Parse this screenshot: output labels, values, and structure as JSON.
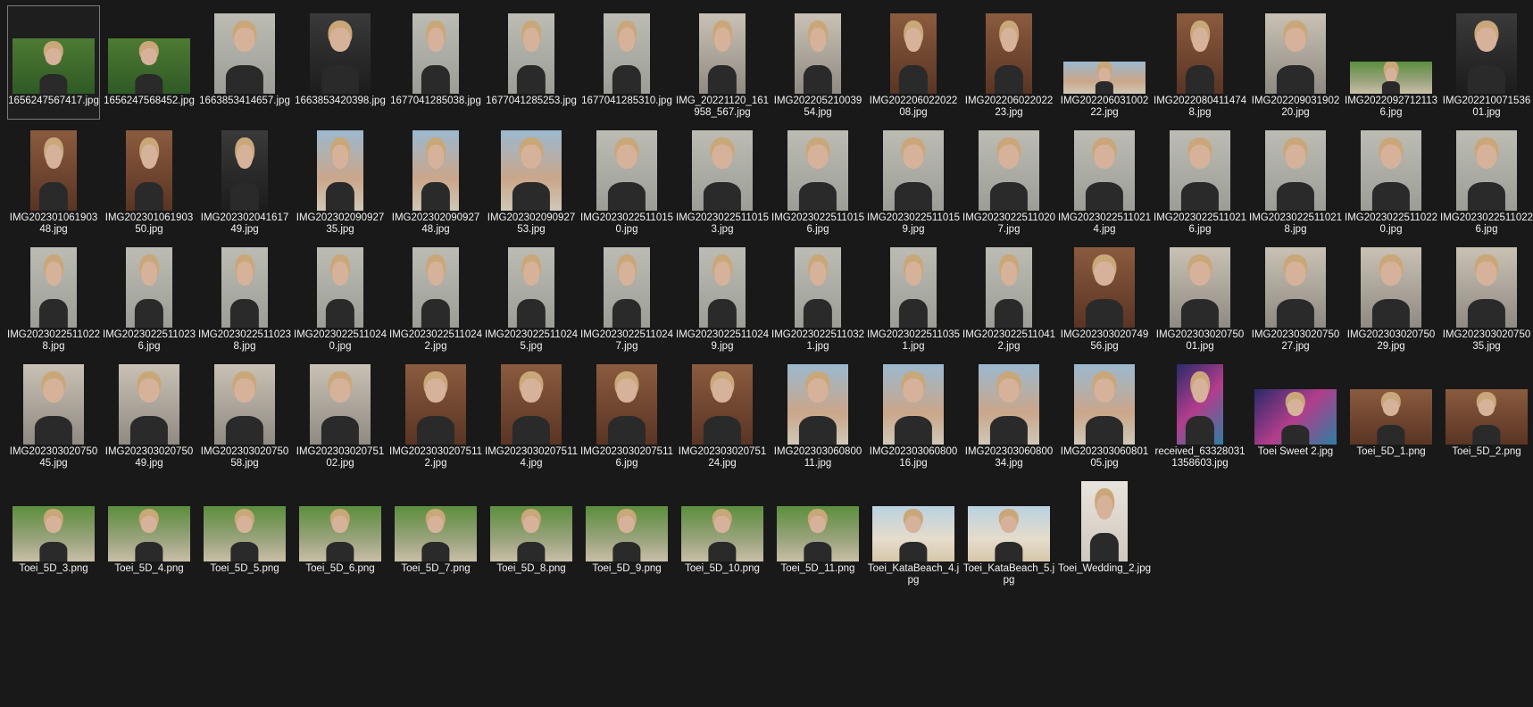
{
  "files": [
    {
      "name": "1656247567417.jpg",
      "thumb": "land green",
      "selected": true
    },
    {
      "name": "1656247568452.jpg",
      "thumb": "land green"
    },
    {
      "name": "1663853414657.jpg",
      "thumb": "portrait grey"
    },
    {
      "name": "1663853420398.jpg",
      "thumb": "portrait dark"
    },
    {
      "name": "1677041285038.jpg",
      "thumb": "tall grey"
    },
    {
      "name": "1677041285253.jpg",
      "thumb": "tall grey"
    },
    {
      "name": "1677041285310.jpg",
      "thumb": "tall grey"
    },
    {
      "name": "IMG_20221120_161958_567.jpg",
      "thumb": "tall room"
    },
    {
      "name": "IMG20220521003954.jpg",
      "thumb": "tall room"
    },
    {
      "name": "IMG20220602202208.jpg",
      "thumb": "tall warm"
    },
    {
      "name": "IMG20220602202223.jpg",
      "thumb": "tall warm"
    },
    {
      "name": "IMG20220603100222.jpg",
      "thumb": "wide outdoor"
    },
    {
      "name": "IMG20220804114748.jpg",
      "thumb": "tall warm"
    },
    {
      "name": "IMG20220903190220.jpg",
      "thumb": "portrait room"
    },
    {
      "name": "IMG20220927121136.jpg",
      "thumb": "wide park"
    },
    {
      "name": "IMG20221007153601.jpg",
      "thumb": "portrait dark"
    },
    {
      "name": "IMG20230106190348.jpg",
      "thumb": "tall warm"
    },
    {
      "name": "IMG20230106190350.jpg",
      "thumb": "tall warm"
    },
    {
      "name": "IMG20230204161749.jpg",
      "thumb": "tall dark"
    },
    {
      "name": "IMG20230209092735.jpg",
      "thumb": "tall outdoor"
    },
    {
      "name": "IMG20230209092748.jpg",
      "thumb": "tall outdoor"
    },
    {
      "name": "IMG20230209092753.jpg",
      "thumb": "portrait outdoor"
    },
    {
      "name": "IMG20230225110150.jpg",
      "thumb": "portrait grey"
    },
    {
      "name": "IMG20230225110153.jpg",
      "thumb": "portrait grey"
    },
    {
      "name": "IMG20230225110156.jpg",
      "thumb": "portrait grey"
    },
    {
      "name": "IMG20230225110159.jpg",
      "thumb": "portrait grey"
    },
    {
      "name": "IMG20230225110207.jpg",
      "thumb": "portrait grey"
    },
    {
      "name": "IMG20230225110214.jpg",
      "thumb": "portrait grey"
    },
    {
      "name": "IMG20230225110216.jpg",
      "thumb": "portrait grey"
    },
    {
      "name": "IMG20230225110218.jpg",
      "thumb": "portrait grey"
    },
    {
      "name": "IMG20230225110220.jpg",
      "thumb": "portrait grey"
    },
    {
      "name": "IMG20230225110226.jpg",
      "thumb": "portrait grey"
    },
    {
      "name": "IMG20230225110228.jpg",
      "thumb": "tall grey"
    },
    {
      "name": "IMG20230225110236.jpg",
      "thumb": "tall grey"
    },
    {
      "name": "IMG20230225110238.jpg",
      "thumb": "tall grey"
    },
    {
      "name": "IMG20230225110240.jpg",
      "thumb": "tall grey"
    },
    {
      "name": "IMG20230225110242.jpg",
      "thumb": "tall grey"
    },
    {
      "name": "IMG20230225110245.jpg",
      "thumb": "tall grey"
    },
    {
      "name": "IMG20230225110247.jpg",
      "thumb": "tall grey"
    },
    {
      "name": "IMG20230225110249.jpg",
      "thumb": "tall grey"
    },
    {
      "name": "IMG20230225110321.jpg",
      "thumb": "tall grey"
    },
    {
      "name": "IMG20230225110351.jpg",
      "thumb": "tall grey"
    },
    {
      "name": "IMG20230225110412.jpg",
      "thumb": "tall grey"
    },
    {
      "name": "IMG20230302074956.jpg",
      "thumb": "portrait warm"
    },
    {
      "name": "IMG20230302075001.jpg",
      "thumb": "portrait room"
    },
    {
      "name": "IMG20230302075027.jpg",
      "thumb": "portrait room"
    },
    {
      "name": "IMG20230302075029.jpg",
      "thumb": "portrait room"
    },
    {
      "name": "IMG20230302075035.jpg",
      "thumb": "portrait room"
    },
    {
      "name": "IMG20230302075045.jpg",
      "thumb": "portrait room"
    },
    {
      "name": "IMG20230302075049.jpg",
      "thumb": "portrait room"
    },
    {
      "name": "IMG20230302075058.jpg",
      "thumb": "portrait room"
    },
    {
      "name": "IMG20230302075102.jpg",
      "thumb": "portrait room"
    },
    {
      "name": "IMG20230302075112.jpg",
      "thumb": "portrait warm"
    },
    {
      "name": "IMG20230302075114.jpg",
      "thumb": "portrait warm"
    },
    {
      "name": "IMG20230302075116.jpg",
      "thumb": "portrait warm"
    },
    {
      "name": "IMG20230302075124.jpg",
      "thumb": "portrait warm"
    },
    {
      "name": "IMG20230306080011.jpg",
      "thumb": "portrait outdoor"
    },
    {
      "name": "IMG20230306080016.jpg",
      "thumb": "portrait outdoor"
    },
    {
      "name": "IMG20230306080034.jpg",
      "thumb": "portrait outdoor"
    },
    {
      "name": "IMG20230306080105.jpg",
      "thumb": "portrait outdoor"
    },
    {
      "name": "received_633280311358603.jpg",
      "thumb": "tall neon"
    },
    {
      "name": "Toei Sweet 2.jpg",
      "thumb": "land neon"
    },
    {
      "name": "Toei_5D_1.png",
      "thumb": "land warm"
    },
    {
      "name": "Toei_5D_2.png",
      "thumb": "land warm"
    },
    {
      "name": "Toei_5D_3.png",
      "thumb": "land park"
    },
    {
      "name": "Toei_5D_4.png",
      "thumb": "land park"
    },
    {
      "name": "Toei_5D_5.png",
      "thumb": "land park"
    },
    {
      "name": "Toei_5D_6.png",
      "thumb": "land park"
    },
    {
      "name": "Toei_5D_7.png",
      "thumb": "land park"
    },
    {
      "name": "Toei_5D_8.png",
      "thumb": "land park"
    },
    {
      "name": "Toei_5D_9.png",
      "thumb": "land park"
    },
    {
      "name": "Toei_5D_10.png",
      "thumb": "land park"
    },
    {
      "name": "Toei_5D_11.png",
      "thumb": "land park"
    },
    {
      "name": "Toei_KataBeach_4.jpg",
      "thumb": "land beach"
    },
    {
      "name": "Toei_KataBeach_5.jpg",
      "thumb": "land beach"
    },
    {
      "name": "Toei_Wedding_2.jpg",
      "thumb": "tall studio"
    }
  ]
}
